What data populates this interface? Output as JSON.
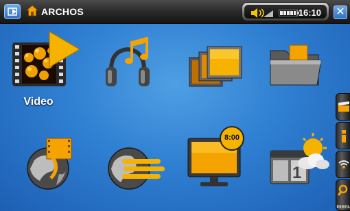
{
  "topbar": {
    "title": "ARCHOS",
    "time": "16:10",
    "close_glyph": "✕"
  },
  "menu": {
    "items": [
      {
        "id": "video",
        "label": "Video",
        "selected": true,
        "icon": "video-film-icon"
      },
      {
        "id": "music",
        "label": "",
        "icon": "headphones-music-icon"
      },
      {
        "id": "photo",
        "label": "",
        "icon": "photo-stack-icon"
      },
      {
        "id": "files",
        "label": "",
        "icon": "folder-icon"
      },
      {
        "id": "internet",
        "label": "",
        "icon": "globe-film-icon"
      },
      {
        "id": "web",
        "label": "",
        "icon": "globe-web-icon"
      },
      {
        "id": "tv",
        "label": "",
        "icon": "tv-clock-icon",
        "badge": "8:00"
      },
      {
        "id": "weather",
        "label": "",
        "icon": "weather-calendar-icon"
      }
    ]
  },
  "sidebar": {
    "menu_label": "menu"
  },
  "colors": {
    "background": "#2f7fd2",
    "accent_orange": "#f5a300",
    "title_bar": "#2a2a2a"
  }
}
